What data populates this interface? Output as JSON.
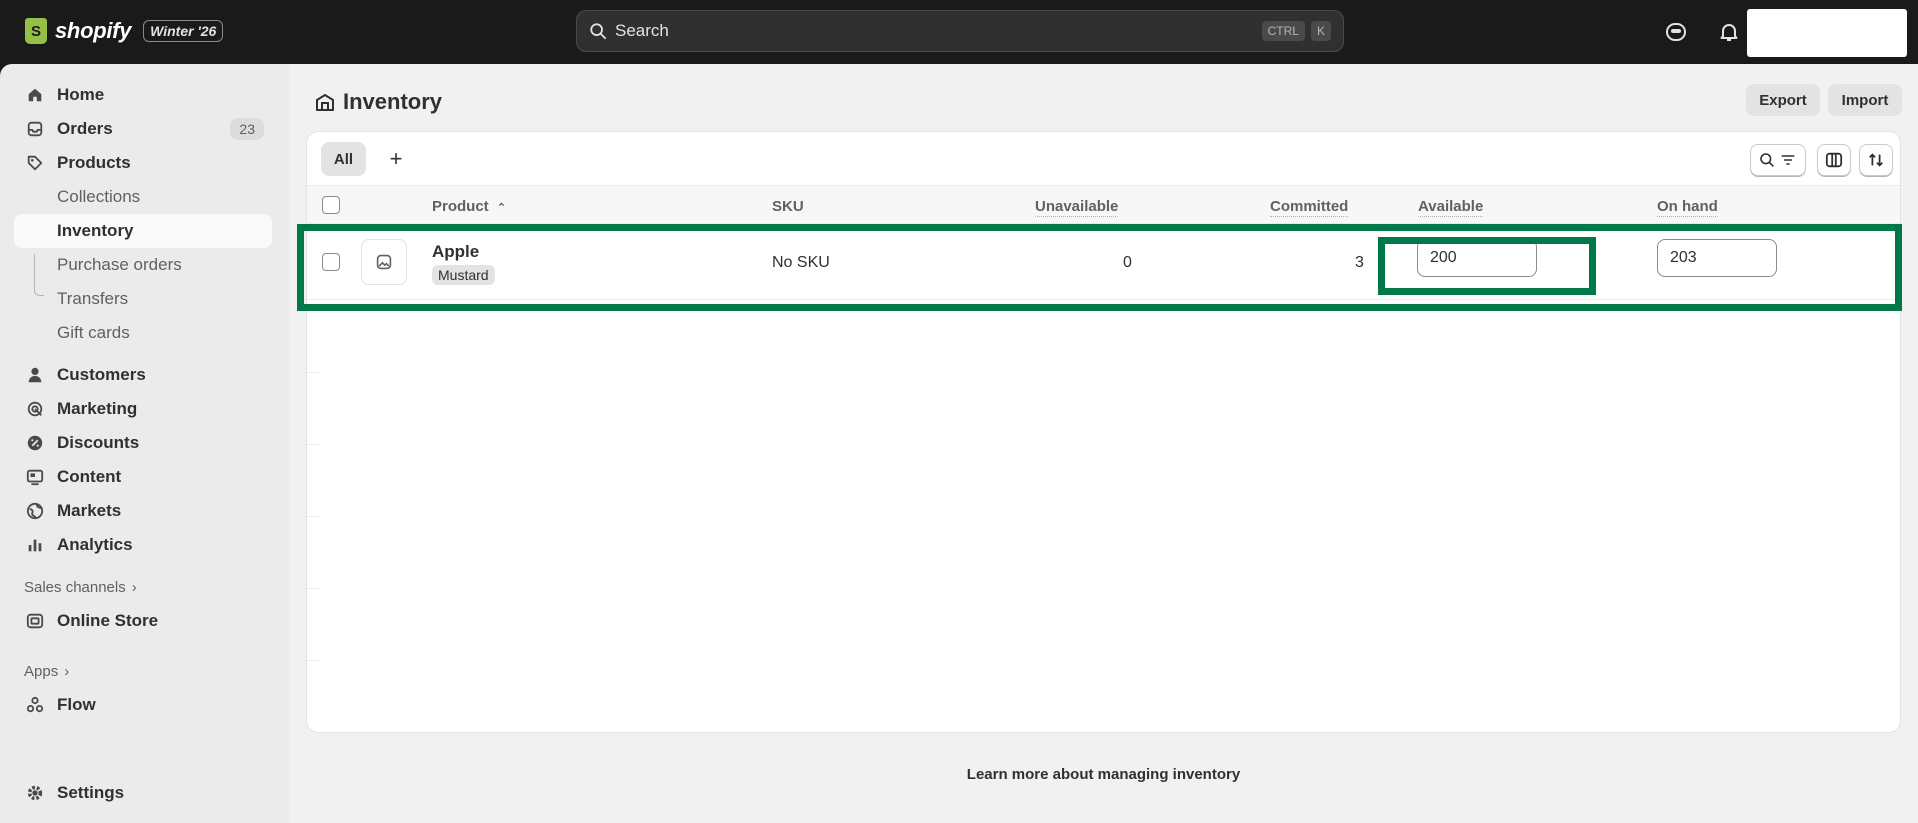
{
  "app": {
    "brand": "shopify",
    "version": "Winter '26"
  },
  "search": {
    "placeholder": "Search",
    "shortcut_mod": "CTRL",
    "shortcut_key": "K"
  },
  "sidebar": {
    "items": [
      {
        "label": "Home",
        "icon": "home-icon"
      },
      {
        "label": "Orders",
        "icon": "orders-icon",
        "badge": "23"
      },
      {
        "label": "Products",
        "icon": "tag-icon"
      },
      {
        "label": "Collections"
      },
      {
        "label": "Inventory"
      },
      {
        "label": "Purchase orders"
      },
      {
        "label": "Transfers"
      },
      {
        "label": "Gift cards"
      },
      {
        "label": "Customers",
        "icon": "person-icon"
      },
      {
        "label": "Marketing",
        "icon": "target-icon"
      },
      {
        "label": "Discounts",
        "icon": "discount-icon"
      },
      {
        "label": "Content",
        "icon": "content-icon"
      },
      {
        "label": "Markets",
        "icon": "globe-icon"
      },
      {
        "label": "Analytics",
        "icon": "bar-chart-icon"
      }
    ],
    "sales_channels_label": "Sales channels",
    "online_store_label": "Online Store",
    "apps_label": "Apps",
    "flow_label": "Flow",
    "settings_label": "Settings"
  },
  "page": {
    "title": "Inventory",
    "export_label": "Export",
    "import_label": "Import"
  },
  "tabs": {
    "all_label": "All",
    "add_label": "+"
  },
  "table": {
    "headers": [
      "Product",
      "SKU",
      "Unavailable",
      "Committed",
      "Available",
      "On hand"
    ],
    "rows": [
      {
        "product": "Apple",
        "variant": "Mustard",
        "sku": "No SKU",
        "unavailable": "0",
        "committed": "3",
        "available": "200",
        "on_hand": "203"
      }
    ]
  },
  "footer": {
    "learn_more": "Learn more about managing inventory"
  },
  "colors": {
    "accent_highlight": "#00784a",
    "topbar": "#1a1a1a",
    "sidebar": "#ebebeb"
  }
}
